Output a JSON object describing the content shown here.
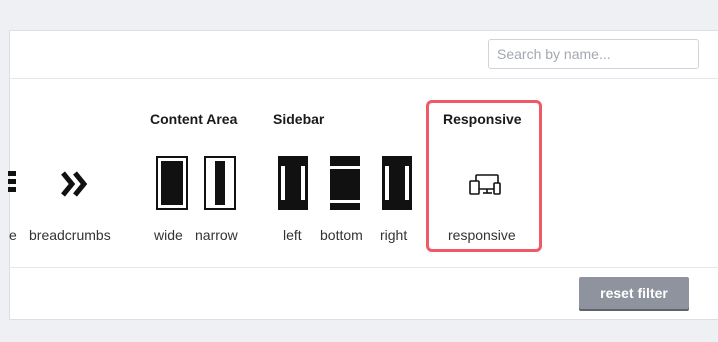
{
  "search": {
    "placeholder": "Search by name..."
  },
  "groups": {
    "content_area": {
      "title": "Content Area"
    },
    "sidebar": {
      "title": "Sidebar"
    },
    "responsive": {
      "title": "Responsive"
    }
  },
  "items": {
    "partial": "e",
    "breadcrumbs": "breadcrumbs",
    "wide": "wide",
    "narrow": "narrow",
    "left": "left",
    "bottom": "bottom",
    "right": "right",
    "responsive": "responsive"
  },
  "icons": {
    "partial": "list-icon",
    "breadcrumbs": "double-chevron-right-icon",
    "wide": "content-wide-icon",
    "narrow": "content-narrow-icon",
    "left": "sidebar-left-icon",
    "bottom": "sidebar-bottom-icon",
    "right": "sidebar-right-icon",
    "responsive": "responsive-devices-icon"
  },
  "buttons": {
    "reset_filter": "reset filter"
  },
  "colors": {
    "highlight": "#ee5a66",
    "button": "#8e939e",
    "page_bg": "#eef0f4"
  }
}
